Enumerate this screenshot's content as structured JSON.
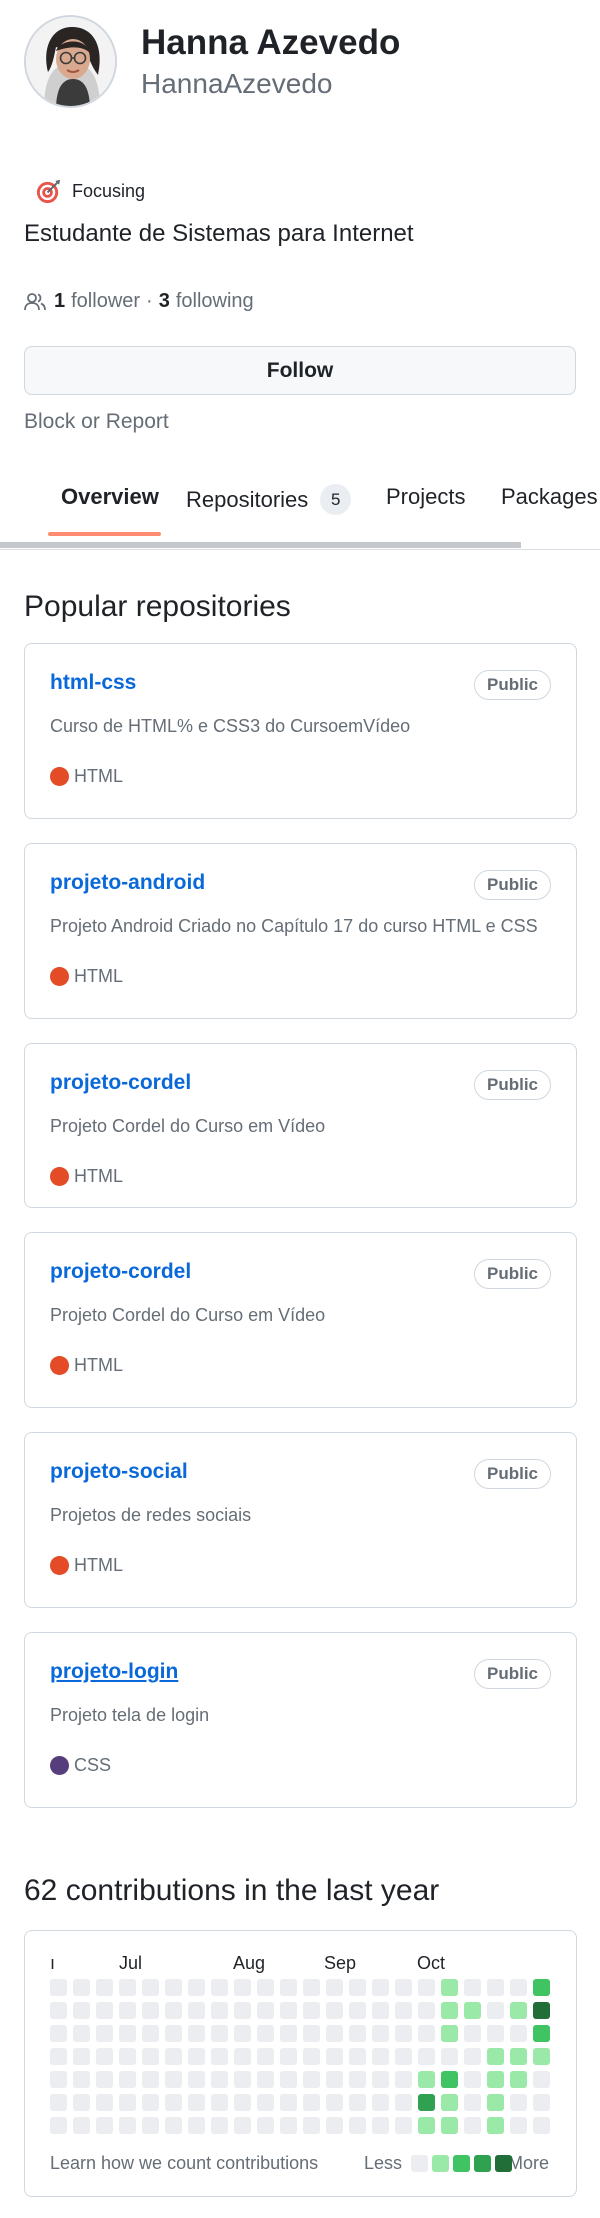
{
  "profile": {
    "name": "Hanna Azevedo",
    "login": "HannaAzevedo",
    "status": "Focusing",
    "bio": "Estudante de Sistemas para Internet",
    "followers_count": "1",
    "followers_label": "follower",
    "separator": "·",
    "following_count": "3",
    "following_label": "following",
    "follow_button": "Follow",
    "block_link": "Block or Report"
  },
  "tabs": [
    {
      "label": "Overview",
      "active": true
    },
    {
      "label": "Repositories",
      "count": "5"
    },
    {
      "label": "Projects"
    },
    {
      "label": "Packages"
    }
  ],
  "popular": {
    "title": "Popular repositories",
    "repos": [
      {
        "name": "html-css",
        "visibility": "Public",
        "description": "Curso de HTML% e CSS3 do CursoemVídeo",
        "language": "HTML",
        "language_color": "#e34c26"
      },
      {
        "name": "projeto-android",
        "visibility": "Public",
        "description": "Projeto Android Criado no Capítulo 17 do curso HTML e CSS",
        "language": "HTML",
        "language_color": "#e34c26"
      },
      {
        "name": "projeto-cordel",
        "visibility": "Public",
        "description": "Projeto Cordel do Curso em Vídeo",
        "language": "HTML",
        "language_color": "#e34c26"
      },
      {
        "name": "projeto-cordel",
        "visibility": "Public",
        "description": "Projeto Cordel do Curso em Vídeo",
        "language": "HTML",
        "language_color": "#e34c26"
      },
      {
        "name": "projeto-social",
        "visibility": "Public",
        "description": "Projetos de redes sociais",
        "language": "HTML",
        "language_color": "#e34c26"
      },
      {
        "name": "projeto-login",
        "visibility": "Public",
        "description": "Projeto tela de login",
        "language": "CSS",
        "language_color": "#563d7c"
      }
    ]
  },
  "contributions": {
    "title": "62 contributions in the last year",
    "months": [
      "Jun",
      "Jul",
      "Aug",
      "Sep",
      "Oct"
    ],
    "month_clipped_text": "ı",
    "learn_link": "Learn how we count contributions",
    "legend_less": "Less",
    "legend_more": "More",
    "level_colors": [
      "#ebedf0",
      "#9be9a8",
      "#40c463",
      "#30a14e",
      "#216e39"
    ],
    "grid_levels": [
      [
        0,
        0,
        0,
        0,
        0,
        0,
        0,
        0,
        0,
        0,
        0,
        0,
        0,
        0,
        0,
        0,
        0,
        1,
        0,
        0,
        0,
        2
      ],
      [
        0,
        0,
        0,
        0,
        0,
        0,
        0,
        0,
        0,
        0,
        0,
        0,
        0,
        0,
        0,
        0,
        0,
        1,
        1,
        0,
        1,
        4
      ],
      [
        0,
        0,
        0,
        0,
        0,
        0,
        0,
        0,
        0,
        0,
        0,
        0,
        0,
        0,
        0,
        0,
        0,
        1,
        0,
        0,
        0,
        2
      ],
      [
        0,
        0,
        0,
        0,
        0,
        0,
        0,
        0,
        0,
        0,
        0,
        0,
        0,
        0,
        0,
        0,
        0,
        0,
        0,
        1,
        1,
        1
      ],
      [
        0,
        0,
        0,
        0,
        0,
        0,
        0,
        0,
        0,
        0,
        0,
        0,
        0,
        0,
        0,
        0,
        1,
        2,
        0,
        1,
        1,
        0
      ],
      [
        0,
        0,
        0,
        0,
        0,
        0,
        0,
        0,
        0,
        0,
        0,
        0,
        0,
        0,
        0,
        0,
        3,
        1,
        0,
        1,
        0,
        0
      ],
      [
        0,
        0,
        0,
        0,
        0,
        0,
        0,
        0,
        0,
        0,
        0,
        0,
        0,
        0,
        0,
        0,
        1,
        1,
        0,
        1,
        0,
        0
      ]
    ]
  }
}
